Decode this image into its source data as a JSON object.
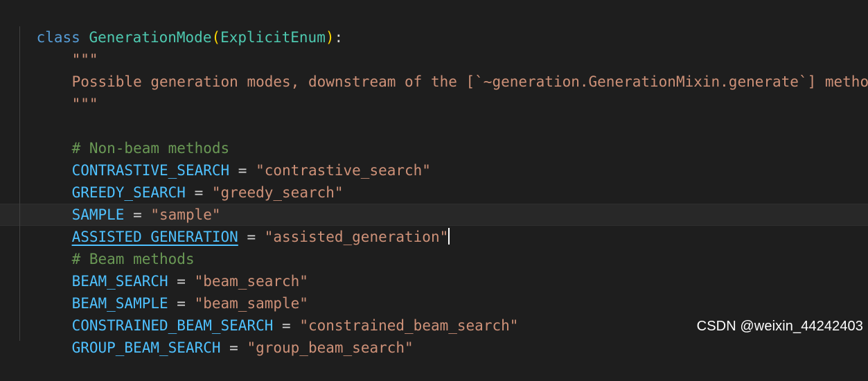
{
  "editor": {
    "class_line": {
      "keyword": "class",
      "name": "GenerationMode",
      "open_paren": "(",
      "base": "ExplicitEnum",
      "close_paren": ")",
      "colon": ":"
    },
    "doc_open": "\"\"\"",
    "doc_text": "Possible generation modes, downstream of the [`~generation.GenerationMixin.generate`] method.",
    "doc_close": "\"\"\"",
    "comment_non_beam": "# Non-beam methods",
    "comment_beam": "# Beam methods",
    "assign_op": " = ",
    "entries": [
      {
        "name": "CONTRASTIVE_SEARCH",
        "value": "\"contrastive_search\""
      },
      {
        "name": "GREEDY_SEARCH",
        "value": "\"greedy_search\""
      },
      {
        "name": "SAMPLE",
        "value": "\"sample\""
      },
      {
        "name": "ASSISTED_GENERATION",
        "value": "\"assisted_generation\""
      },
      {
        "name": "BEAM_SEARCH",
        "value": "\"beam_search\""
      },
      {
        "name": "BEAM_SAMPLE",
        "value": "\"beam_sample\""
      },
      {
        "name": "CONSTRAINED_BEAM_SEARCH",
        "value": "\"constrained_beam_search\""
      },
      {
        "name": "GROUP_BEAM_SEARCH",
        "value": "\"group_beam_search\""
      }
    ]
  },
  "watermark": "CSDN @weixin_44242403",
  "colors": {
    "background": "#1e1e1e",
    "keyword": "#569cd6",
    "class_name": "#4ec9b0",
    "paren": "#ffd700",
    "string": "#ce9178",
    "comment": "#6a9955",
    "constant": "#4fc1ff"
  }
}
